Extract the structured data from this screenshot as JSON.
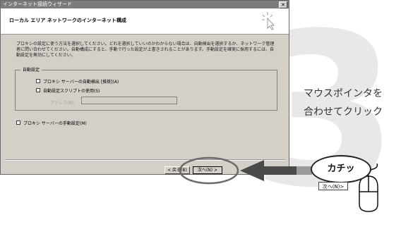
{
  "dialog": {
    "title": "インターネット接続ウィザード",
    "close_glyph": "✕",
    "header": "ローカル エリア ネットワークのインターネット構成",
    "description": "プロキシの設定に使う方法を選択してください。どれを選択していいのかわからない場合は、自動検出を選択するか、ネットワーク管理者に問い合わせてください。自動構成にすると、手動で行った設定が上書きされることがあります。手動設定を確実に採用するには、自動設定を無効にしてください。",
    "group_title": "自動設定",
    "options": {
      "auto_detect": "プロキシ サーバーの自動検出 [推奨](A)",
      "auto_script": "自動設定スクリプトの使用(S)",
      "manual": "プロキシ サーバーの手動設定(M)"
    },
    "address_label": "アドレス(R):",
    "buttons": {
      "back": "< 戻る(B)",
      "next": "次へ(N) >"
    }
  },
  "annotation": {
    "step_number": "3",
    "caption_line1": "マウスポインタを",
    "caption_line2": "合わせてクリック",
    "bubble_text": "カチッ",
    "mini_button": "次へ(N)>"
  }
}
